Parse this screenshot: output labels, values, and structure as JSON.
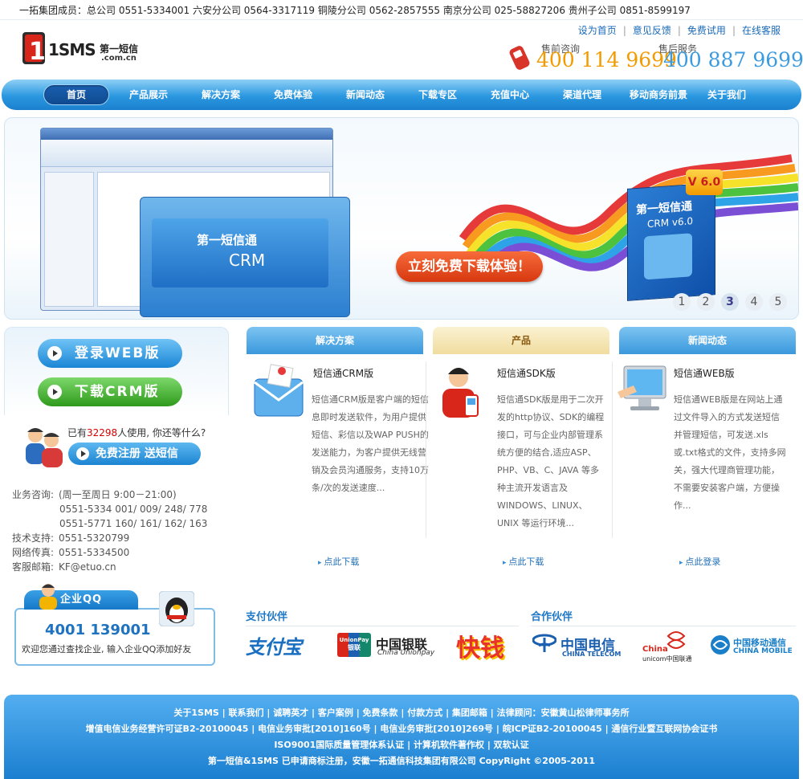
{
  "topbar": {
    "text": "一拓集团成员：总公司 0551-5334001   六安分公司 0564-3317119   铜陵分公司 0562-2857555   南京分公司 025-58827206   贵州子公司 0851-8599197"
  },
  "header": {
    "logo_text": "1SMS",
    "logo_sub": "第一短信",
    "logo_domain": ".com.cn",
    "links": [
      "设为首页",
      "意见反馈",
      "免费试用",
      "在线客服"
    ],
    "presale_label": "售前咨询",
    "presale_number": "400 114 9699",
    "aftersale_label": "售后服务",
    "aftersale_number": "400 887 9699"
  },
  "nav": {
    "items": [
      "首页",
      "产品展示",
      "解决方案",
      "免费体验",
      "新闻动态",
      "下载专区",
      "充值中心",
      "渠道代理",
      "移动商务前景",
      "关于我们"
    ]
  },
  "banner": {
    "cta": "立刻免费下载体验！",
    "product_box_title": "第一短信通",
    "product_box_sub": "CRM v6.0",
    "version_badge": "V 6.0",
    "screenshot_title": "第一短信通",
    "screenshot_sub": "CRM",
    "pages": [
      "1",
      "2",
      "3",
      "4",
      "5"
    ],
    "current_page": "3"
  },
  "left": {
    "login_btn": "登录WEB版",
    "download_btn": "下载CRM版",
    "users_prefix": "已有",
    "users_count": "32298",
    "users_suffix": "人使用, 你还等什么?",
    "register_btn": "免费注册 送短信",
    "contact": {
      "biz_label": "业务咨询:",
      "biz_hours": "(周一至周日 9:00－21:00)",
      "biz_line1": "0551-5334 001/ 009/ 248/ 778",
      "biz_line2": "0551-5771 160/ 161/ 162/ 163",
      "tech_label": "技术支持:",
      "tech": "0551-5320799",
      "fax_label": "网络传真:",
      "fax": "0551-5334500",
      "mail_label": "客服邮箱:",
      "mail": "KF@etuo.cn"
    },
    "qq": {
      "tab": "企业QQ",
      "number": "4001 139001",
      "desc": "欢迎您通过查找企业, 输入企业QQ添加好友"
    }
  },
  "columns": [
    {
      "header": "解决方案",
      "title": "短信通CRM版",
      "body": "短信通CRM版是客户端的短信息即时发送软件，为用户提供短信、彩信以及WAP PUSH的发送能力，为客户提供无线营销及会员沟通服务，支持10万条/次的发送速度...",
      "link": "点此下载"
    },
    {
      "header": "产品",
      "title": "短信通SDK版",
      "body": "短信通SDK版是用于二次开发的http协议、SDK的编程接口，可与企业内部管理系统方便的结合,适应ASP、PHP、VB、C、JAVA 等多种主流开发语言及WINDOWS、LINUX、UNIX 等运行环境...",
      "link": "点此下载"
    },
    {
      "header": "新闻动态",
      "title": "短信通WEB版",
      "body": "短信通WEB版是在网站上通过文件导入的方式发送短信并管理短信，可发送.xls或.txt格式的文件，支持多网关，强大代理商管理功能，不需要安装客户端，方便操作...",
      "link": "点此登录"
    }
  ],
  "partners": {
    "pay_label": "支付伙伴",
    "coop_label": "合作伙伴",
    "alipay": "支付宝",
    "unionpay_cn": "中国银联",
    "unionpay_en": "China Unionpay",
    "unionpay_badge": "UnionPay",
    "unionpay_badge_cn": "银联",
    "kuaiqian": "快钱",
    "telecom_cn": "中国电信",
    "telecom_en": "CHINA TELECOM",
    "unicom_top": "China",
    "unicom_bottom": "unicom中国联通",
    "mobile_cn": "中国移动通信",
    "mobile_en": "CHINA MOBILE"
  },
  "footer": {
    "line1": "关于1SMS  |  联系我们  |  诚聘英才  |  客户案例  |  免费条款  |  付款方式  |  集团邮箱  |  法律顾问：安徽黄山松律师事务所",
    "line2": "增值电信业务经营许可证B2-20100045  |  电信业务审批[2010]160号  |  电信业务审批[2010]269号  |  皖ICP证B2-20100045  |  通信行业暨互联网协会证书",
    "line3": "ISO9001国际质量管理体系认证  |  计算机软件著作权  |  双软认证",
    "line4": "第一短信&1SMS 已申请商标注册，安徽一拓通信科技集团有限公司 CopyRight ©2005-2011"
  },
  "colors": {
    "nav_blue": "#2a97e0",
    "phone_orange": "#f39a00",
    "phone_blue": "#3a9be0",
    "cta_red": "#d7380f",
    "green_btn": "#2f9a1c",
    "highlight_red": "#d40000"
  }
}
